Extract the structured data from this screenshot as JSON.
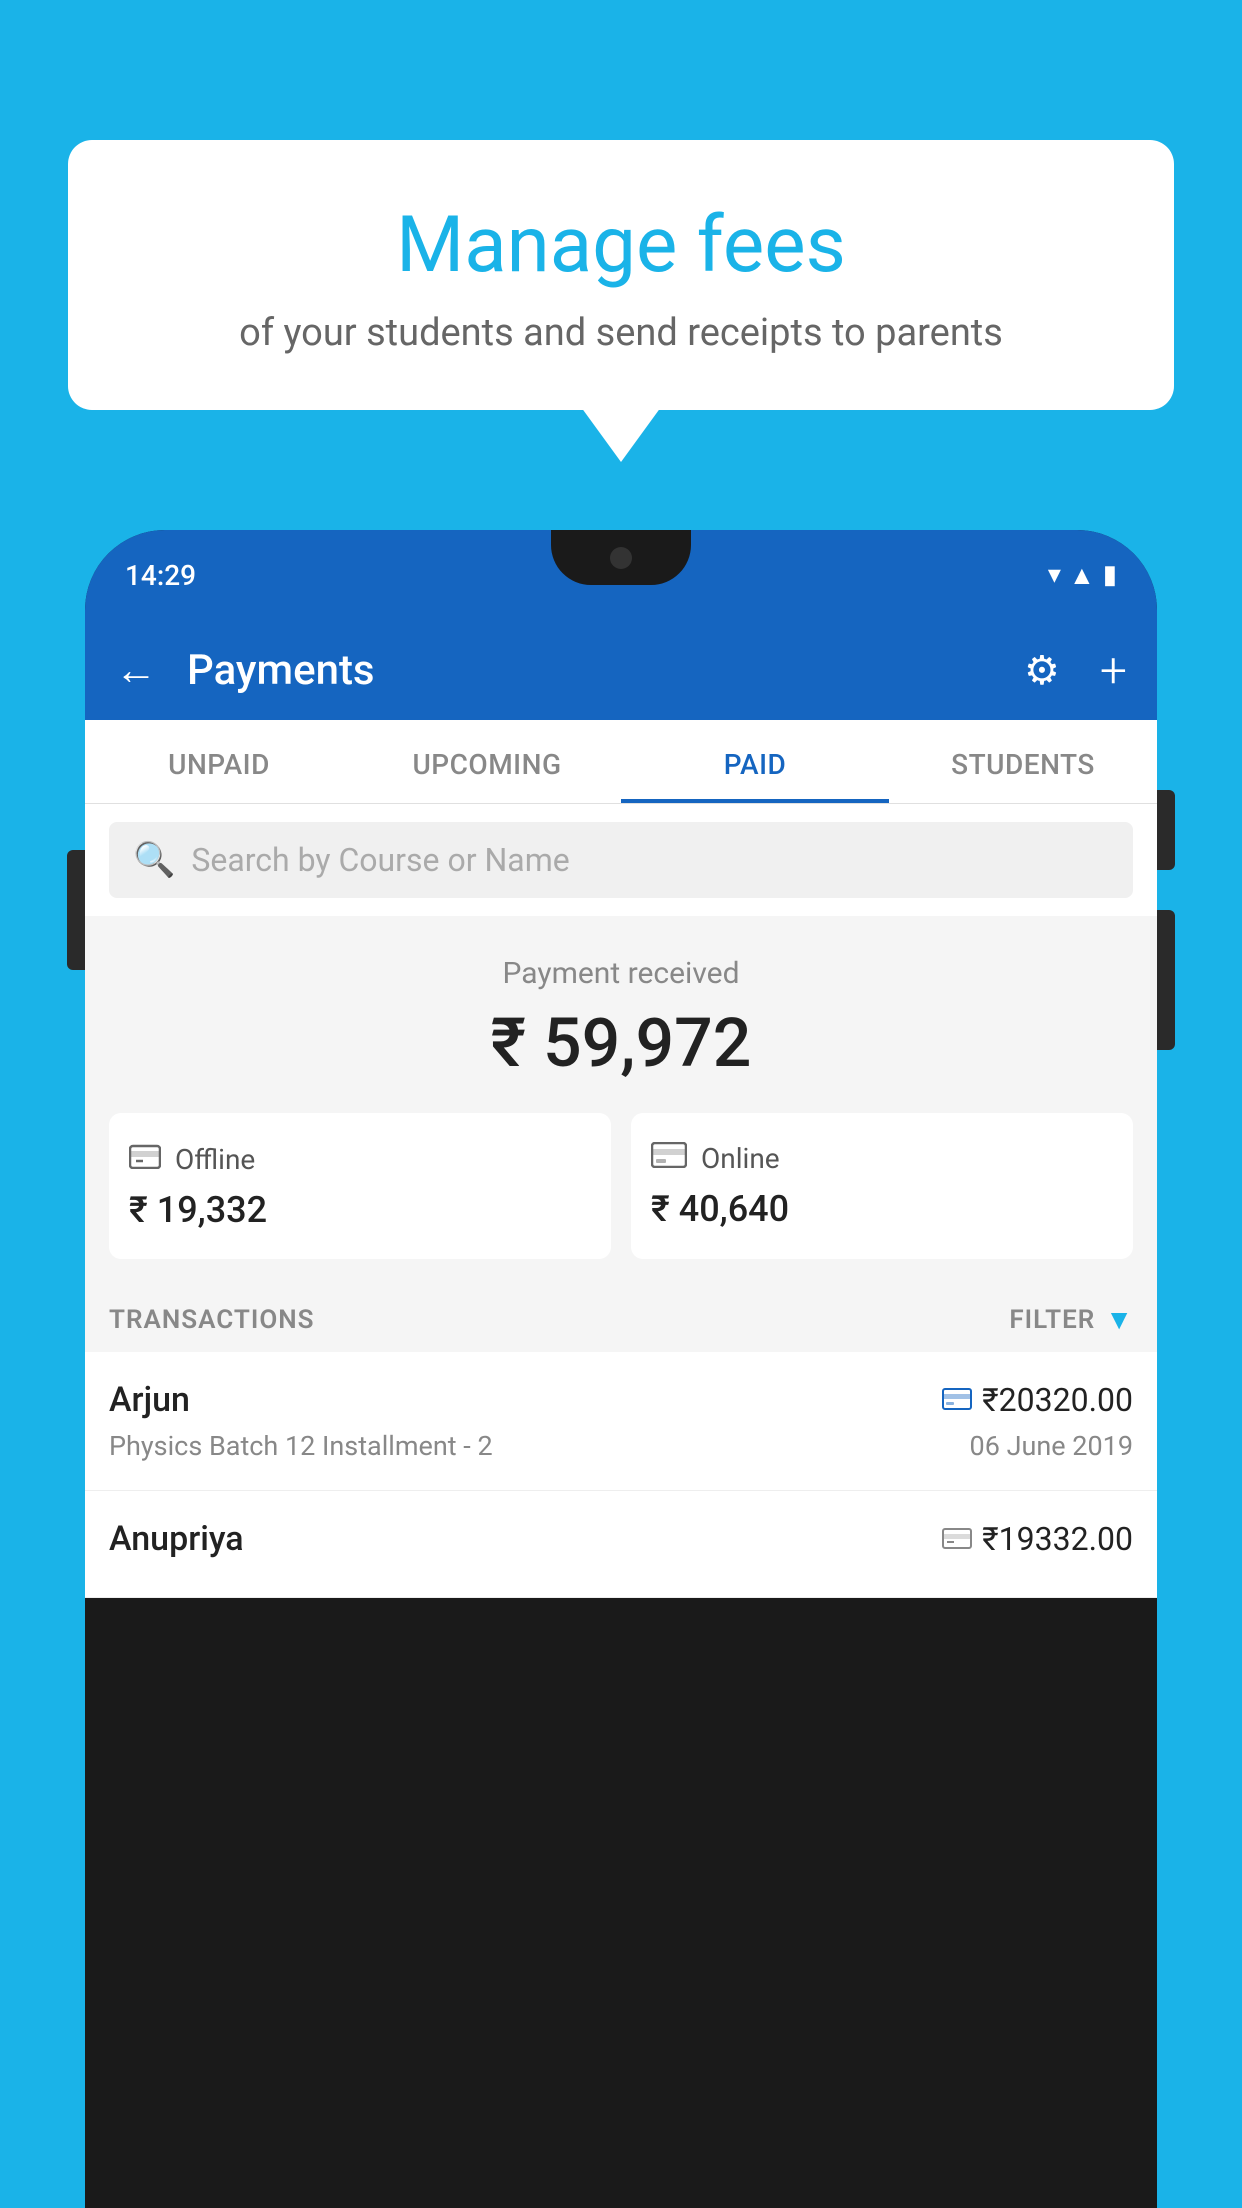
{
  "background_color": "#1ab3e8",
  "speech_bubble": {
    "title": "Manage fees",
    "subtitle": "of your students and send receipts to parents"
  },
  "status_bar": {
    "time": "14:29",
    "icons": "▾◂▮"
  },
  "app_header": {
    "title": "Payments",
    "back_label": "←",
    "gear_label": "⚙",
    "plus_label": "+"
  },
  "tabs": [
    {
      "label": "UNPAID",
      "active": false
    },
    {
      "label": "UPCOMING",
      "active": false
    },
    {
      "label": "PAID",
      "active": true
    },
    {
      "label": "STUDENTS",
      "active": false
    }
  ],
  "search": {
    "placeholder": "Search by Course or Name"
  },
  "payment_received": {
    "label": "Payment received",
    "amount": "₹ 59,972"
  },
  "payment_methods": [
    {
      "icon": "🪙",
      "label": "Offline",
      "amount": "₹ 19,332"
    },
    {
      "icon": "💳",
      "label": "Online",
      "amount": "₹ 40,640"
    }
  ],
  "transactions_header": {
    "label": "TRANSACTIONS",
    "filter_label": "FILTER"
  },
  "transactions": [
    {
      "name": "Arjun",
      "course": "Physics Batch 12 Installment - 2",
      "amount": "₹20320.00",
      "date": "06 June 2019",
      "method": "online"
    },
    {
      "name": "Anupriya",
      "course": "",
      "amount": "₹19332.00",
      "date": "",
      "method": "offline"
    }
  ]
}
